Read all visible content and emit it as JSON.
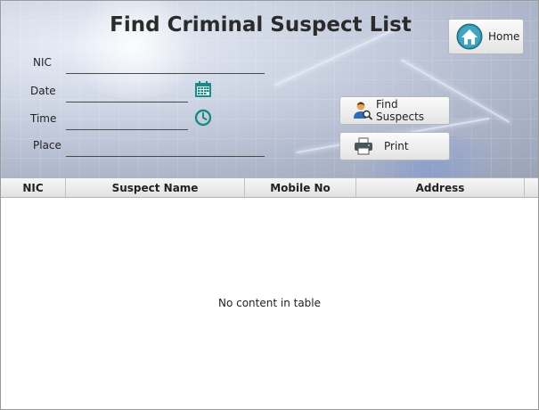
{
  "window": {
    "title": "Find Criminal Suspect List"
  },
  "home_button": {
    "label": "Home",
    "icon": "home-icon"
  },
  "form": {
    "nic": {
      "label": "NIC",
      "value": ""
    },
    "date": {
      "label": "Date",
      "value": "",
      "icon": "calendar-icon"
    },
    "time": {
      "label": "Time",
      "value": "",
      "icon": "clock-icon"
    },
    "place": {
      "label": "Place",
      "value": ""
    }
  },
  "actions": {
    "find": {
      "label": "Find Suspects",
      "icon": "user-search-icon"
    },
    "print": {
      "label": "Print",
      "icon": "printer-icon"
    }
  },
  "table": {
    "columns": [
      "NIC",
      "Suspect Name",
      "Mobile No",
      "Address"
    ],
    "rows": [],
    "placeholder": "No content in table"
  },
  "colors": {
    "accent_teal": "#1a8a86",
    "header_bg": "#b9c1d4"
  }
}
